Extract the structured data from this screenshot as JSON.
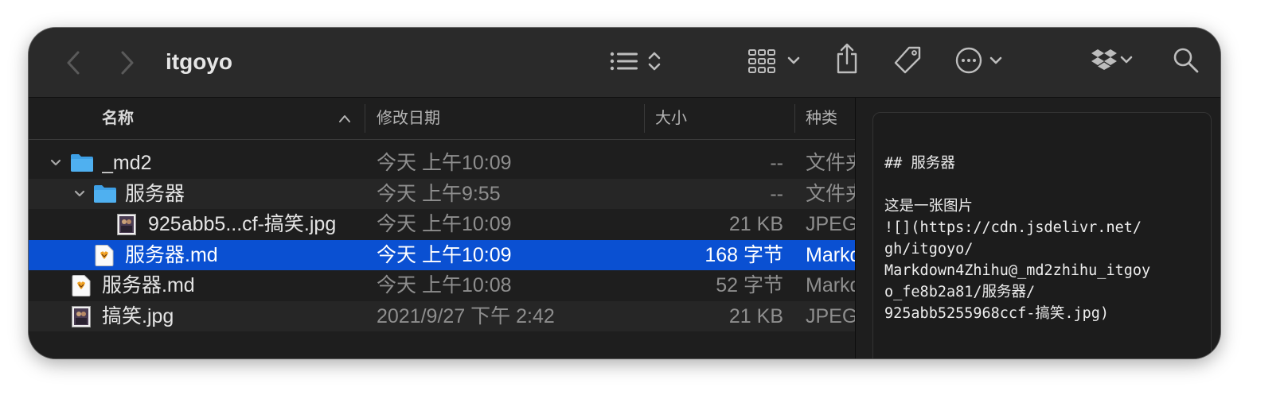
{
  "window": {
    "title": "itgoyo"
  },
  "toolbar": {
    "icons": [
      "back-icon",
      "forward-icon",
      "list-view-icon",
      "sort-icon",
      "group-view-icon",
      "share-icon",
      "tag-icon",
      "more-icon",
      "dropbox-icon",
      "search-icon"
    ]
  },
  "columns": {
    "name": "名称",
    "date": "修改日期",
    "size": "大小",
    "kind": "种类"
  },
  "files": [
    {
      "name": "_md2",
      "date": "今天 上午10:09",
      "size": "--",
      "kind": "文件夹",
      "icon": "folder-icon",
      "level": 0,
      "disclosure": "expanded"
    },
    {
      "name": "服务器",
      "date": "今天 上午9:55",
      "size": "--",
      "kind": "文件夹",
      "icon": "folder-icon",
      "level": 1,
      "disclosure": "expanded"
    },
    {
      "name": "925abb5...cf-搞笑.jpg",
      "date": "今天 上午10:09",
      "size": "21 KB",
      "kind": "JPEG图像",
      "icon": "image-file-icon",
      "level": 2,
      "disclosure": "none"
    },
    {
      "name": "服务器.md",
      "date": "今天 上午10:09",
      "size": "168 字节",
      "kind": "Markdown",
      "icon": "markdown-file-icon",
      "level": 1,
      "disclosure": "none",
      "selected": true
    },
    {
      "name": "服务器.md",
      "date": "今天 上午10:08",
      "size": "52 字节",
      "kind": "Markdown",
      "icon": "markdown-file-icon",
      "level": 0,
      "disclosure": "none"
    },
    {
      "name": "搞笑.jpg",
      "date": "2021/9/27 下午 2:42",
      "size": "21 KB",
      "kind": "JPEG图像",
      "icon": "image-file-icon",
      "level": 0,
      "disclosure": "none"
    }
  ],
  "preview": {
    "lines": [
      "## 服务器",
      "",
      "这是一张图片",
      "![](https://cdn.jsdelivr.net/",
      "gh/itgoyo/",
      "Markdown4Zhihu@_md2zhihu_itgoy",
      "o_fe8b2a81/服务器/",
      "925abb5255968ccf-搞笑.jpg)"
    ]
  },
  "colors": {
    "selection": "#0a50d2",
    "folder": "#3ea0e6",
    "window_bg": "#1e1e1e",
    "toolbar_bg": "#2a2a2a"
  }
}
